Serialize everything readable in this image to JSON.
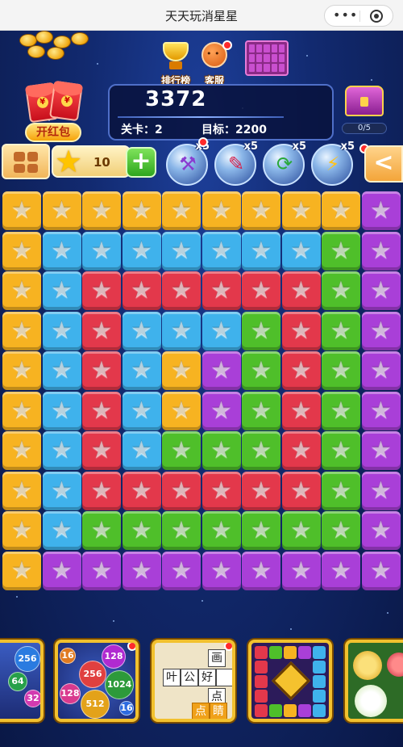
{
  "window": {
    "title": "天天玩消星星",
    "more_icon": "more-dots-icon",
    "close_icon": "close-circle-icon"
  },
  "header": {
    "red_packet_label": "开红包",
    "leaderboard_label": "排行榜",
    "service_label": "客服",
    "level_select_icon": "level-grid-icon"
  },
  "score_panel": {
    "score": "3372",
    "level_text": "关卡：2",
    "target_text": "目标：2200"
  },
  "treasure": {
    "progress": "0/5"
  },
  "toolbar": {
    "star_count": "10",
    "add_label": "+",
    "tools": [
      {
        "name": "hammer",
        "icon": "hammer-icon",
        "qty": "x5"
      },
      {
        "name": "pen",
        "icon": "pen-icon",
        "qty": "x5"
      },
      {
        "name": "refresh",
        "icon": "refresh-icon",
        "qty": "x5"
      },
      {
        "name": "lightning",
        "icon": "lightning-icon",
        "qty": "x5"
      }
    ],
    "back_label": "<"
  },
  "colors": {
    "Y": "#f7b321",
    "B": "#3fb2ec",
    "R": "#e3384b",
    "G": "#4fbf2a",
    "P": "#a93fd8"
  },
  "board": {
    "columns": 10,
    "rows": [
      "YYYYYYYYYP",
      "YBBBBBBBGP",
      "YBRRRRRRGP",
      "YBRBBBGRGP",
      "YBRBYPGRGP",
      "YBRBYPGRGP",
      "YBRBGGGRGP",
      "YBRRRRRRGP",
      "YBGGGGGGGP",
      "YPPPPPPPPP"
    ]
  },
  "promos": [
    {
      "name": "ball-merge-game",
      "balls": [
        "256",
        "64",
        "32"
      ]
    },
    {
      "name": "number-ball-game",
      "balls": [
        "128",
        "256",
        "1024",
        "512",
        "16",
        "128",
        "16"
      ]
    },
    {
      "name": "word-puzzle-game",
      "chars": [
        "画",
        "叶",
        "公",
        "好",
        "点",
        "点",
        "睛"
      ]
    },
    {
      "name": "block-puzzle-game"
    },
    {
      "name": "fruit-game"
    }
  ]
}
